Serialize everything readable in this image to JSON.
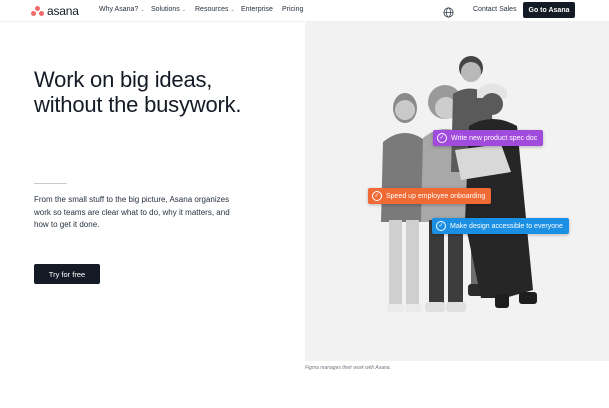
{
  "nav": {
    "brand": "asana",
    "links": [
      {
        "label": "Why Asana?",
        "has_dropdown": true
      },
      {
        "label": "Solutions",
        "has_dropdown": true
      },
      {
        "label": "Resources",
        "has_dropdown": true
      },
      {
        "label": "Enterprise",
        "has_dropdown": false
      },
      {
        "label": "Pricing",
        "has_dropdown": false
      }
    ],
    "globe_icon": "globe-icon",
    "contact_label": "Contact Sales",
    "cta_label": "Go to Asana"
  },
  "hero": {
    "headline_line1": "Work on big ideas,",
    "headline_line2": "without the busywork.",
    "body": "From the small stuff to the big picture, Asana organizes work so teams are clear what to do, why it matters, and how to get it done.",
    "cta_label": "Try for free",
    "caption": "Figma manages their work with Asana."
  },
  "tasks": [
    {
      "label": "Write new product spec doc",
      "color": "#a04bdc"
    },
    {
      "label": "Speed up employee onboarding",
      "color": "#f06a35"
    },
    {
      "label": "Make design accessible to everyone",
      "color": "#1a8fe3"
    }
  ],
  "colors": {
    "brand_dot": "#f06a6a",
    "dark_button": "#151b26",
    "photo_bg": "#f2f2f2"
  }
}
